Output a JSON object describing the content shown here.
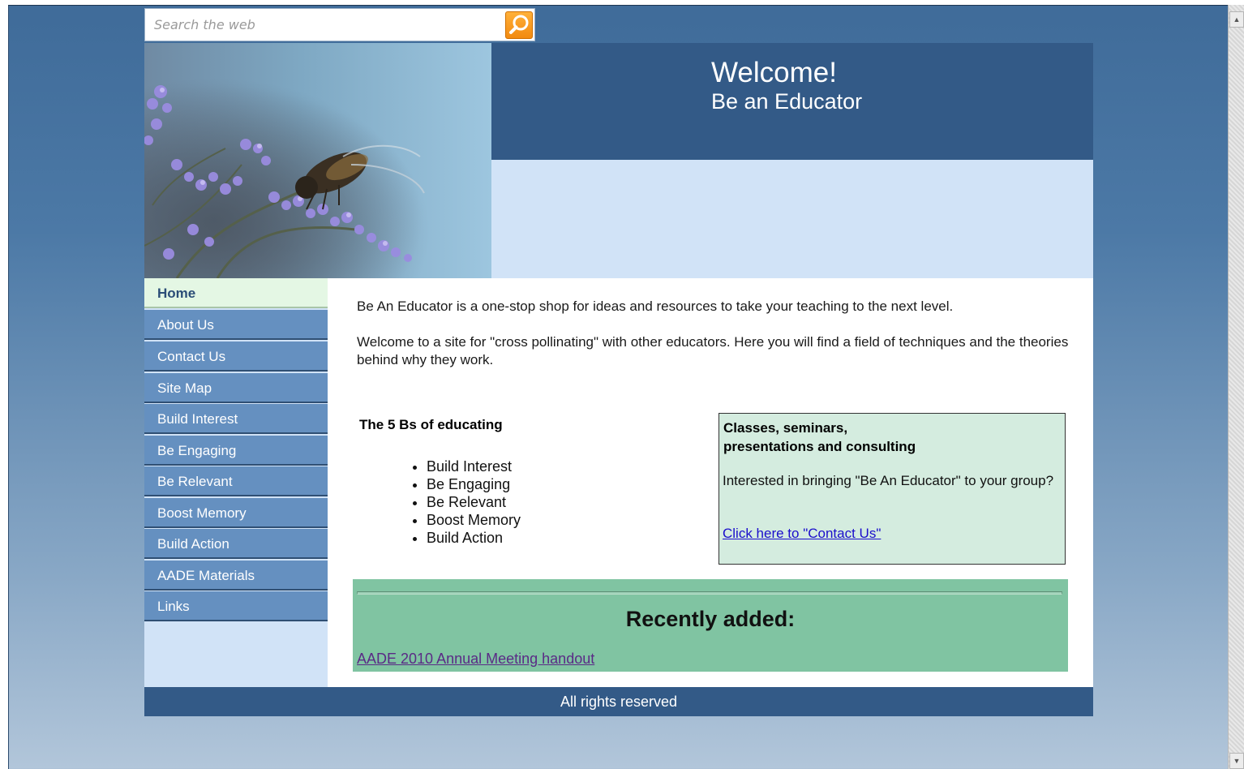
{
  "search": {
    "placeholder": "Search the web"
  },
  "header": {
    "title": "Welcome!",
    "subtitle": "Be an Educator"
  },
  "sidebar": {
    "items": [
      {
        "label": "Home"
      },
      {
        "label": "About Us"
      },
      {
        "label": "Contact Us"
      },
      {
        "label": "Site Map"
      },
      {
        "label": "Build Interest"
      },
      {
        "label": "Be Engaging"
      },
      {
        "label": "Be Relevant"
      },
      {
        "label": "Boost Memory"
      },
      {
        "label": "Build Action"
      },
      {
        "label": "AADE Materials"
      },
      {
        "label": "Links"
      }
    ]
  },
  "main": {
    "intro_1": "Be An Educator is a one-stop shop for ideas and resources to take your teaching to the next level.",
    "intro_2": "Welcome to a site for \"cross pollinating\" with other educators. Here you will find a field of techniques and the theories behind why they work.",
    "bs_heading": "The 5 Bs of educating",
    "bs_items": [
      "Build Interest",
      "Be Engaging",
      "Be Relevant",
      "Boost Memory",
      "Build Action"
    ],
    "classes": {
      "title_line1": "Classes, seminars,",
      "title_line2": "presentations and consulting",
      "text": "Interested in bringing \"Be An Educator\" to your group?",
      "link": "Click here to \"Contact Us\""
    },
    "recent": {
      "title": "Recently added:",
      "link": "AADE 2010 Annual Meeting handout"
    }
  },
  "footer": {
    "text": "All rights reserved"
  },
  "colors": {
    "header_band": "#335a87",
    "nav_item": "#6590c0",
    "nav_active": "#e4f7e4",
    "classes_box": "#d4ecdf",
    "recent_box": "#80c4a2",
    "search_button": "#f28a10"
  },
  "icons": {
    "search_button": "search-icon",
    "scroll_up": "scroll-up-arrow-icon",
    "scroll_down": "scroll-down-arrow-icon"
  }
}
